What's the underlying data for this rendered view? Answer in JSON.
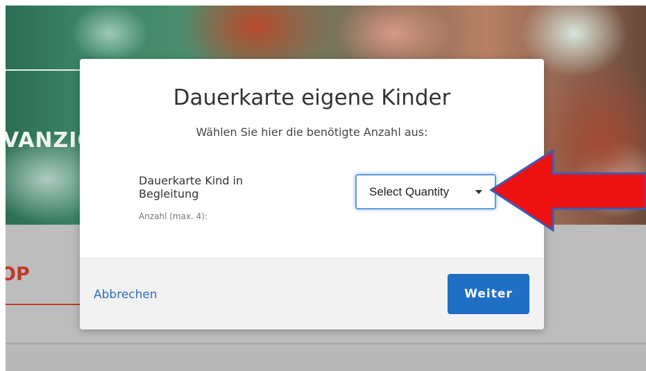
{
  "background": {
    "hero_text": "VANZIG",
    "section_label": "OP"
  },
  "modal": {
    "title": "Dauerkarte eigene Kinder",
    "subtitle": "Wählen Sie hier die benötigte Anzahl aus:",
    "field_label": "Dauerkarte Kind in Begleitung",
    "field_hint": "Anzahl (max. 4):",
    "quantity_select": {
      "value": "Select Quantity",
      "icon": "caret-down-icon"
    },
    "cancel_label": "Abbrechen",
    "continue_label": "Weiter"
  },
  "annotation": {
    "icon": "red-arrow-left-icon",
    "color": "#ee1111"
  },
  "colors": {
    "primary_button": "#1f6fc5",
    "link": "#2f6fb6",
    "accent_red": "#c0392b",
    "focus_ring": "#5b9bd8"
  }
}
